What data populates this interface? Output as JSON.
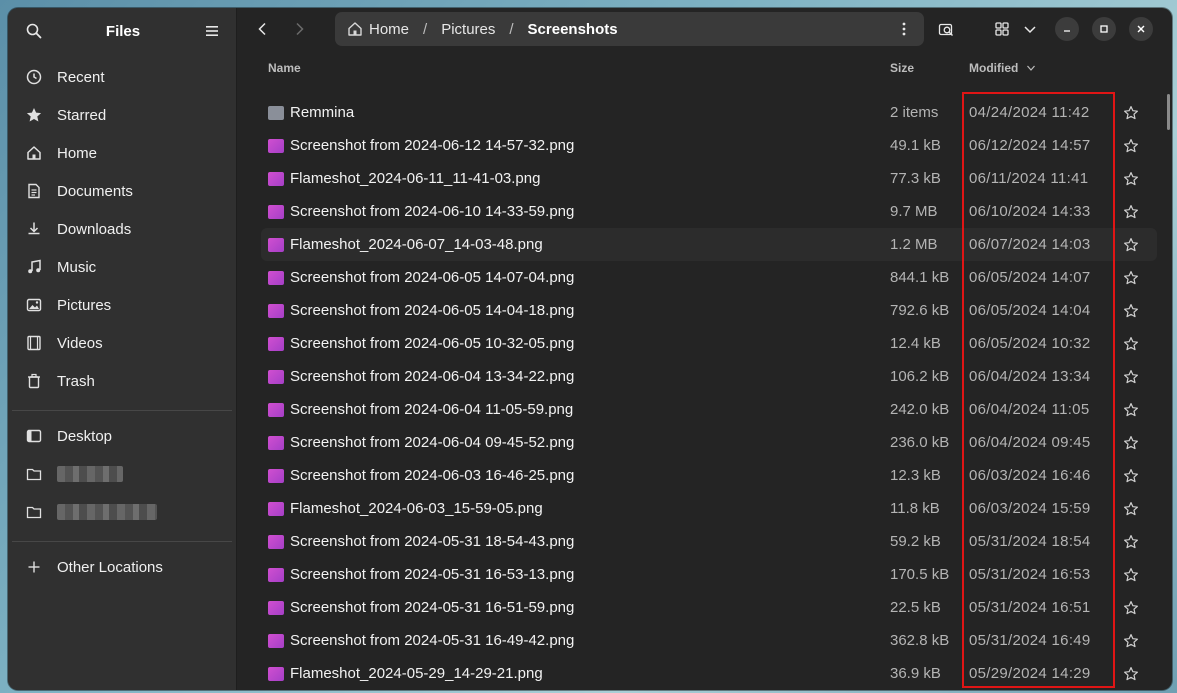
{
  "sidebar": {
    "title": "Files",
    "places": [
      {
        "label": "Recent",
        "icon": "clock-icon"
      },
      {
        "label": "Starred",
        "icon": "star-icon"
      },
      {
        "label": "Home",
        "icon": "home-icon"
      },
      {
        "label": "Documents",
        "icon": "document-icon"
      },
      {
        "label": "Downloads",
        "icon": "download-icon"
      },
      {
        "label": "Music",
        "icon": "music-icon"
      },
      {
        "label": "Pictures",
        "icon": "picture-icon"
      },
      {
        "label": "Videos",
        "icon": "video-icon"
      },
      {
        "label": "Trash",
        "icon": "trash-icon"
      }
    ],
    "bookmarks": [
      {
        "label": "Desktop",
        "icon": "desktop-icon"
      }
    ],
    "other_locations": "Other Locations"
  },
  "pathbar": {
    "crumbs": [
      "Home",
      "Pictures",
      "Screenshots"
    ]
  },
  "columns": {
    "name": "Name",
    "size": "Size",
    "modified": "Modified"
  },
  "files": [
    {
      "name": "Remmina",
      "size": "2 items",
      "modified": "04/24/2024 11:42",
      "type": "folder"
    },
    {
      "name": "Screenshot from 2024-06-12 14-57-32.png",
      "size": "49.1 kB",
      "modified": "06/12/2024 14:57",
      "type": "image"
    },
    {
      "name": "Flameshot_2024-06-11_11-41-03.png",
      "size": "77.3 kB",
      "modified": "06/11/2024 11:41",
      "type": "image"
    },
    {
      "name": "Screenshot from 2024-06-10 14-33-59.png",
      "size": "9.7 MB",
      "modified": "06/10/2024 14:33",
      "type": "image"
    },
    {
      "name": "Flameshot_2024-06-07_14-03-48.png",
      "size": "1.2 MB",
      "modified": "06/07/2024 14:03",
      "type": "image"
    },
    {
      "name": "Screenshot from 2024-06-05 14-07-04.png",
      "size": "844.1 kB",
      "modified": "06/05/2024 14:07",
      "type": "image"
    },
    {
      "name": "Screenshot from 2024-06-05 14-04-18.png",
      "size": "792.6 kB",
      "modified": "06/05/2024 14:04",
      "type": "image"
    },
    {
      "name": "Screenshot from 2024-06-05 10-32-05.png",
      "size": "12.4 kB",
      "modified": "06/05/2024 10:32",
      "type": "image"
    },
    {
      "name": "Screenshot from 2024-06-04 13-34-22.png",
      "size": "106.2 kB",
      "modified": "06/04/2024 13:34",
      "type": "image"
    },
    {
      "name": "Screenshot from 2024-06-04 11-05-59.png",
      "size": "242.0 kB",
      "modified": "06/04/2024 11:05",
      "type": "image"
    },
    {
      "name": "Screenshot from 2024-06-04 09-45-52.png",
      "size": "236.0 kB",
      "modified": "06/04/2024 09:45",
      "type": "image"
    },
    {
      "name": "Screenshot from 2024-06-03 16-46-25.png",
      "size": "12.3 kB",
      "modified": "06/03/2024 16:46",
      "type": "image"
    },
    {
      "name": "Flameshot_2024-06-03_15-59-05.png",
      "size": "11.8 kB",
      "modified": "06/03/2024 15:59",
      "type": "image"
    },
    {
      "name": "Screenshot from 2024-05-31 18-54-43.png",
      "size": "59.2 kB",
      "modified": "05/31/2024 18:54",
      "type": "image"
    },
    {
      "name": "Screenshot from 2024-05-31 16-53-13.png",
      "size": "170.5 kB",
      "modified": "05/31/2024 16:53",
      "type": "image"
    },
    {
      "name": "Screenshot from 2024-05-31 16-51-59.png",
      "size": "22.5 kB",
      "modified": "05/31/2024 16:51",
      "type": "image"
    },
    {
      "name": "Screenshot from 2024-05-31 16-49-42.png",
      "size": "362.8 kB",
      "modified": "05/31/2024 16:49",
      "type": "image"
    },
    {
      "name": "Flameshot_2024-05-29_14-29-21.png",
      "size": "36.9 kB",
      "modified": "05/29/2024 14:29",
      "type": "image"
    }
  ],
  "colors": {
    "highlight": "#e01515",
    "image_icon": "#c04bd0",
    "folder_icon": "#8a8f99"
  }
}
